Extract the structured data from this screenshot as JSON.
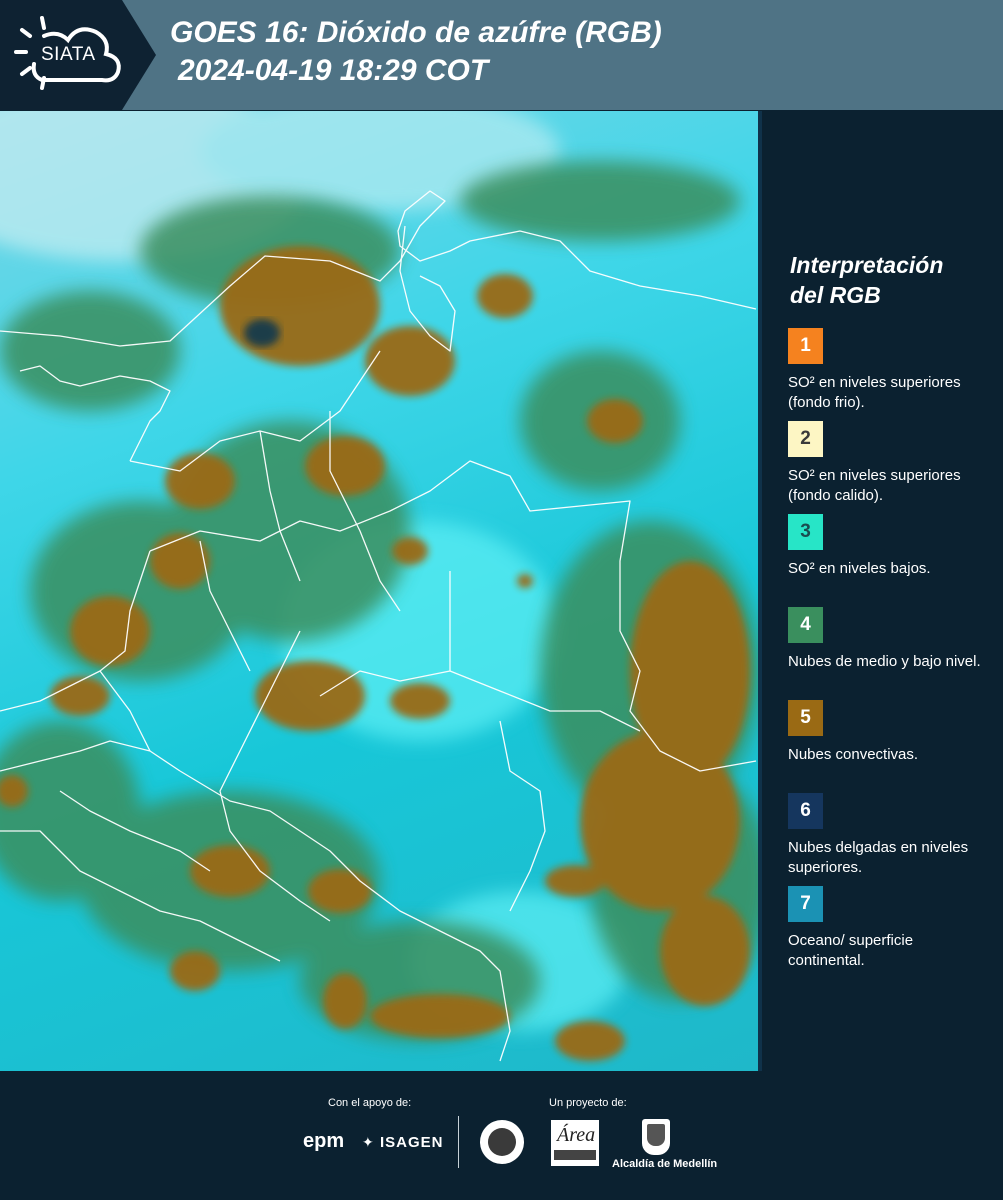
{
  "header": {
    "logo_text": "SIATA",
    "title_line1": "GOES 16: Dióxido de azúfre (RGB)",
    "title_line2": "2024-04-19 18:29 COT"
  },
  "legend": {
    "title_line1": "Interpretación",
    "title_line2": "del RGB",
    "items": [
      {
        "number": "1",
        "label": "SO² en niveles superiores (fondo frio).",
        "color": "#f5821f",
        "text_color": "#ffffff"
      },
      {
        "number": "2",
        "label": "SO² en niveles superiores (fondo calido).",
        "color": "#fdf6c4",
        "text_color": "#3a3a3a"
      },
      {
        "number": "3",
        "label": "SO² en niveles bajos.",
        "color": "#27e5c7",
        "text_color": "#1a4d50"
      },
      {
        "number": "4",
        "label": "Nubes de medio y bajo nivel.",
        "color": "#3a8f5e",
        "text_color": "#ffffff"
      },
      {
        "number": "5",
        "label": "Nubes convectivas.",
        "color": "#9a6a14",
        "text_color": "#ffffff"
      },
      {
        "number": "6",
        "label": "Nubes delgadas en niveles superiores.",
        "color": "#15365e",
        "text_color": "#ffffff"
      },
      {
        "number": "7",
        "label": "Oceano/ superficie continental.",
        "color": "#1b92b4",
        "text_color": "#ffffff"
      }
    ]
  },
  "footer": {
    "apoyo_label": "Con el apoyo de:",
    "proyecto_label": "Un proyecto de:",
    "epm_text": "epm",
    "isagen_text": "ISAGEN",
    "alcaldia_text": "Alcaldía de Medellín"
  },
  "colors": {
    "header_bg": "#4f7385",
    "panel_bg": "#0b2130",
    "cloud_convective": "#9a6a14",
    "cloud_mid_low": "#3a8f5e",
    "surface": "#1fc3d6"
  }
}
